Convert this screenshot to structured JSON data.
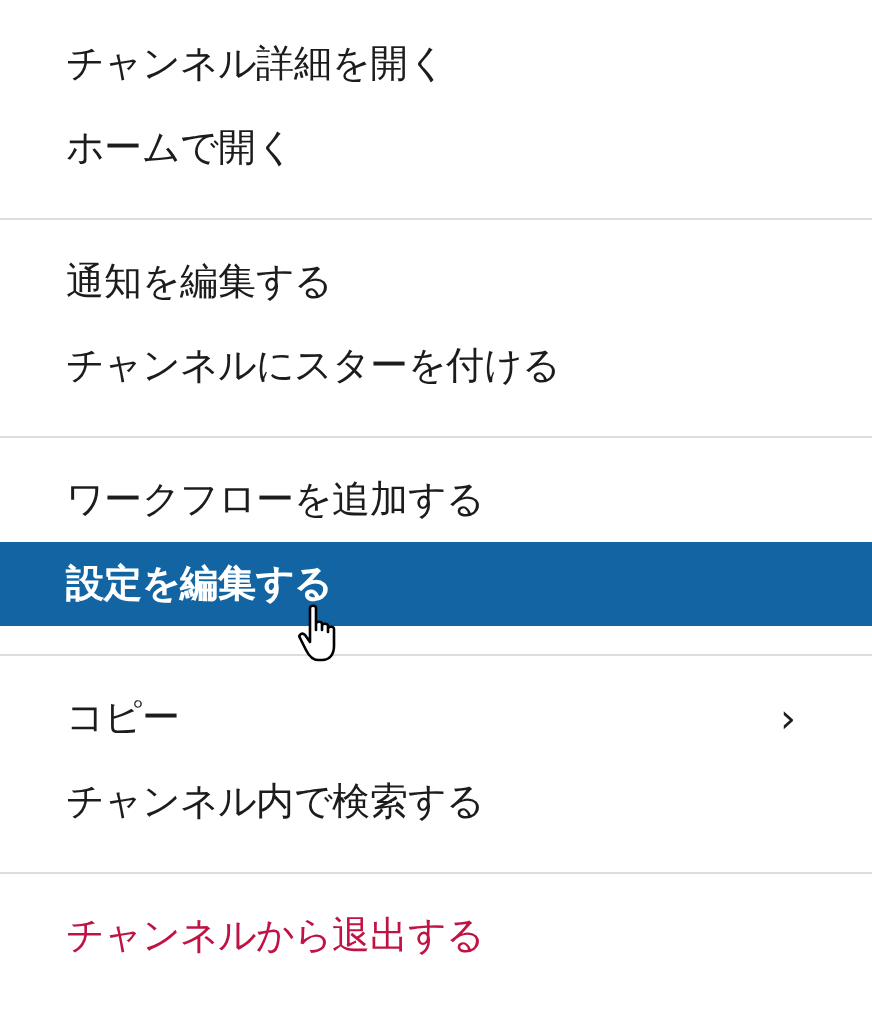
{
  "menu": {
    "groups": [
      {
        "items": [
          {
            "label": "チャンネル詳細を開く",
            "selected": false,
            "kind": "normal"
          },
          {
            "label": "ホームで開く",
            "selected": false,
            "kind": "normal"
          }
        ]
      },
      {
        "items": [
          {
            "label": "通知を編集する",
            "selected": false,
            "kind": "normal"
          },
          {
            "label": "チャンネルにスターを付ける",
            "selected": false,
            "kind": "normal"
          }
        ]
      },
      {
        "items": [
          {
            "label": "ワークフローを追加する",
            "selected": false,
            "kind": "normal"
          },
          {
            "label": "設定を編集する",
            "selected": true,
            "kind": "normal"
          }
        ]
      },
      {
        "items": [
          {
            "label": "コピー",
            "selected": false,
            "kind": "normal",
            "arrow": "›"
          },
          {
            "label": "チャンネル内で検索する",
            "selected": false,
            "kind": "normal"
          }
        ]
      },
      {
        "items": [
          {
            "label": "チャンネルから退出する",
            "selected": false,
            "kind": "danger"
          }
        ]
      }
    ]
  }
}
